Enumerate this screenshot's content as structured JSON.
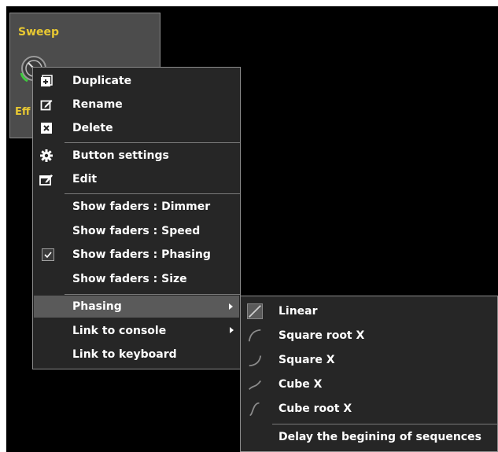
{
  "effect": {
    "title": "Sweep",
    "subtitle": "Eff"
  },
  "context_menu": {
    "items": [
      {
        "label": "Duplicate",
        "icon": "duplicate-icon"
      },
      {
        "label": "Rename",
        "icon": "rename-icon"
      },
      {
        "label": "Delete",
        "icon": "delete-icon"
      },
      {
        "label": "Button settings",
        "icon": "gear-icon"
      },
      {
        "label": "Edit",
        "icon": "edit-icon"
      },
      {
        "label": "Show faders : Dimmer"
      },
      {
        "label": "Show faders : Speed"
      },
      {
        "label": "Show faders : Phasing",
        "checked": true
      },
      {
        "label": "Show faders : Size"
      },
      {
        "label": "Phasing",
        "has_submenu": true,
        "highlighted": true
      },
      {
        "label": "Link to console",
        "has_submenu": true
      },
      {
        "label": "Link to keyboard"
      }
    ]
  },
  "phasing_submenu": {
    "items": [
      {
        "label": "Linear",
        "icon": "linear-curve-icon",
        "selected": true
      },
      {
        "label": "Square root X",
        "icon": "square-root-curve-icon"
      },
      {
        "label": "Square X",
        "icon": "square-curve-icon"
      },
      {
        "label": "Cube X",
        "icon": "cube-curve-icon"
      },
      {
        "label": "Cube root X",
        "icon": "cube-root-curve-icon"
      },
      {
        "label": "Delay the begining of sequences"
      }
    ]
  },
  "colors": {
    "menu_bg": "#262626",
    "highlight": "#5a5a5a",
    "effect_title": "#e8c832"
  }
}
